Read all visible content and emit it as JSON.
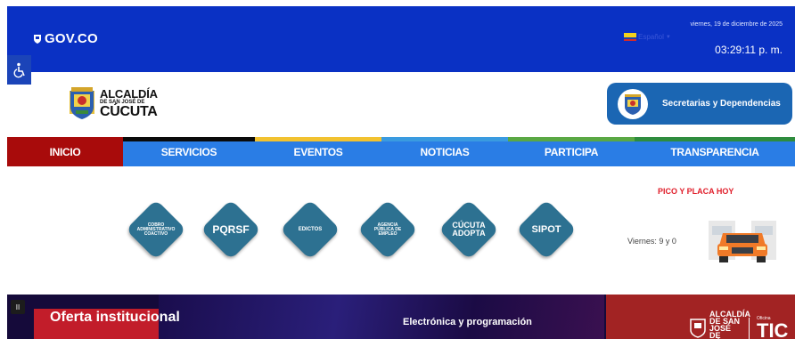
{
  "gov_bar": {
    "logo_text": "GOV.CO",
    "language": "Español",
    "date": "viernes, 19 de diciembre de 2025",
    "time": "03:29:11 p. m."
  },
  "header": {
    "brand_line1": "ALCALDÍA",
    "brand_line2": "DE SAN JOSÉ DE",
    "brand_line3": "CÚCUTA",
    "secretarias_button": "Secretarias y Dependencias"
  },
  "nav": [
    {
      "label": "INICIO",
      "strip": "#a80b0b",
      "active": true
    },
    {
      "label": "SERVICIOS",
      "strip": "#0b0b0b",
      "active": false
    },
    {
      "label": "EVENTOS",
      "strip": "#f2c230",
      "active": false
    },
    {
      "label": "NOTICIAS",
      "strip": "#3a9be0",
      "active": false
    },
    {
      "label": "PARTICIPA",
      "strip": "#5aa844",
      "active": false
    },
    {
      "label": "TRANSPARENCIA",
      "strip": "#2e8c3e",
      "active": false
    }
  ],
  "quick_links": [
    {
      "label": "COBRO ADMINISTRATIVO COACTIVO"
    },
    {
      "label": "PQRSF"
    },
    {
      "label": "EDICTOS"
    },
    {
      "label": "AGENCIA PÚBLICA DE EMPLEO"
    },
    {
      "label": "CÚCUTA ADOPTA"
    },
    {
      "label": "SIPOT"
    }
  ],
  "pico_placa": {
    "title": "PICO Y PLACA HOY",
    "text": "Viernes: 9 y 0"
  },
  "banner": {
    "pause_label": "II",
    "offer_text": "Oferta institucional",
    "course_text": "Electrónica y programación",
    "logo_alcaldia": "ALCALDÍA DE SAN JOSÉ DE CÚCUTA",
    "logo_oficina": "Oficina",
    "logo_tic": "TIC"
  },
  "colors": {
    "gov_blue": "#0a31c4",
    "nav_blue": "#2a7de5",
    "nav_active": "#a80b0b",
    "diamond": "#2d7191",
    "pyp_red": "#e01e2a"
  }
}
